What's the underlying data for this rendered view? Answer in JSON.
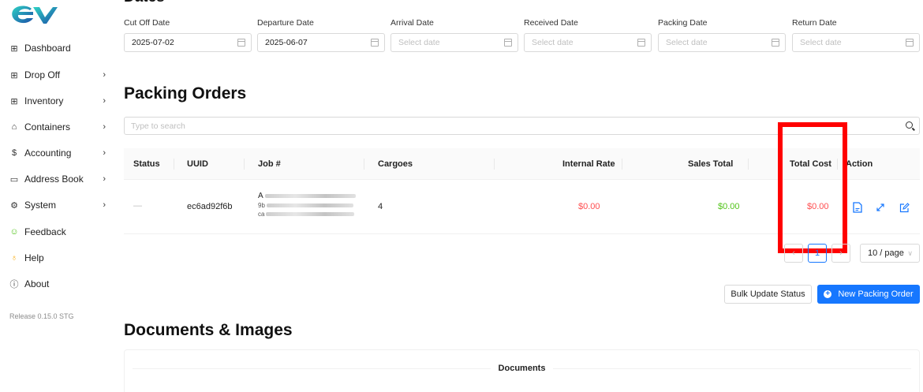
{
  "sidebar": {
    "items": [
      {
        "label": "Dashboard",
        "icon": "grid-icon",
        "glyph": "⊞",
        "chevron": false
      },
      {
        "label": "Drop Off",
        "icon": "grid-icon",
        "glyph": "⊞",
        "chevron": true
      },
      {
        "label": "Inventory",
        "icon": "grid-icon",
        "glyph": "⊞",
        "chevron": true
      },
      {
        "label": "Containers",
        "icon": "containers-icon",
        "glyph": "⌂",
        "chevron": true
      },
      {
        "label": "Accounting",
        "icon": "dollar-icon",
        "glyph": "$",
        "chevron": true
      },
      {
        "label": "Address Book",
        "icon": "address-book-icon",
        "glyph": "▭",
        "chevron": true
      },
      {
        "label": "System",
        "icon": "gear-icon",
        "glyph": "⚙",
        "chevron": true
      },
      {
        "label": "Feedback",
        "icon": "smile-icon",
        "glyph": "☺",
        "chevron": false
      },
      {
        "label": "Help",
        "icon": "bulb-icon",
        "glyph": "♁",
        "chevron": false
      },
      {
        "label": "About",
        "icon": "info-icon",
        "glyph": "ⓘ",
        "chevron": false
      }
    ],
    "release": "Release 0.15.0 STG",
    "chevron_glyph": "›"
  },
  "colors": {
    "primary": "#1677ff",
    "red": "#ff4d4f",
    "green": "#52c41a",
    "highlight": "#ff0000"
  },
  "dates": {
    "title": "Dates",
    "fields": [
      {
        "label": "Cut Off Date",
        "value": "2025-07-02"
      },
      {
        "label": "Departure Date",
        "value": "2025-06-07"
      },
      {
        "label": "Arrival Date",
        "placeholder": "Select date"
      },
      {
        "label": "Received Date",
        "placeholder": "Select date"
      },
      {
        "label": "Packing Date",
        "placeholder": "Select date"
      },
      {
        "label": "Return Date",
        "placeholder": "Select date"
      }
    ]
  },
  "packing": {
    "title": "Packing Orders",
    "search_placeholder": "Type to search",
    "columns": [
      "Status",
      "UUID",
      "Job #",
      "Cargoes",
      "Internal Rate",
      "Sales Total",
      "Total Cost",
      "Action"
    ],
    "rows": [
      {
        "status": "—",
        "uuid": "ec6ad92f6b",
        "job_line1": "A",
        "job_line2": "9b",
        "job_line3": "ca",
        "cargoes": "4",
        "internal_rate": "$0.00",
        "sales_total": "$0.00",
        "total_cost": "$0.00"
      }
    ],
    "pagination": {
      "current": "1",
      "prev": "‹",
      "next": "›",
      "page_size": "10 / page"
    },
    "bulk_label": "Bulk Update Status",
    "new_label": "New Packing Order"
  },
  "docs": {
    "title": "Documents & Images",
    "section": "Documents"
  }
}
